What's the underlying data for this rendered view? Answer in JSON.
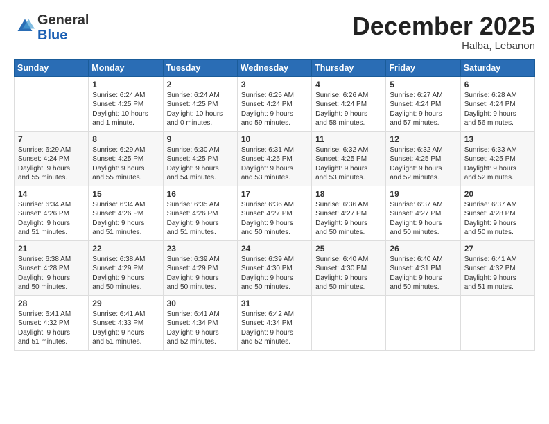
{
  "logo": {
    "general": "General",
    "blue": "Blue"
  },
  "header": {
    "month": "December 2025",
    "location": "Halba, Lebanon"
  },
  "days_of_week": [
    "Sunday",
    "Monday",
    "Tuesday",
    "Wednesday",
    "Thursday",
    "Friday",
    "Saturday"
  ],
  "weeks": [
    [
      {
        "day": "",
        "info": ""
      },
      {
        "day": "1",
        "info": "Sunrise: 6:24 AM\nSunset: 4:25 PM\nDaylight: 10 hours\nand 1 minute."
      },
      {
        "day": "2",
        "info": "Sunrise: 6:24 AM\nSunset: 4:25 PM\nDaylight: 10 hours\nand 0 minutes."
      },
      {
        "day": "3",
        "info": "Sunrise: 6:25 AM\nSunset: 4:24 PM\nDaylight: 9 hours\nand 59 minutes."
      },
      {
        "day": "4",
        "info": "Sunrise: 6:26 AM\nSunset: 4:24 PM\nDaylight: 9 hours\nand 58 minutes."
      },
      {
        "day": "5",
        "info": "Sunrise: 6:27 AM\nSunset: 4:24 PM\nDaylight: 9 hours\nand 57 minutes."
      },
      {
        "day": "6",
        "info": "Sunrise: 6:28 AM\nSunset: 4:24 PM\nDaylight: 9 hours\nand 56 minutes."
      }
    ],
    [
      {
        "day": "7",
        "info": "Sunrise: 6:29 AM\nSunset: 4:24 PM\nDaylight: 9 hours\nand 55 minutes."
      },
      {
        "day": "8",
        "info": "Sunrise: 6:29 AM\nSunset: 4:25 PM\nDaylight: 9 hours\nand 55 minutes."
      },
      {
        "day": "9",
        "info": "Sunrise: 6:30 AM\nSunset: 4:25 PM\nDaylight: 9 hours\nand 54 minutes."
      },
      {
        "day": "10",
        "info": "Sunrise: 6:31 AM\nSunset: 4:25 PM\nDaylight: 9 hours\nand 53 minutes."
      },
      {
        "day": "11",
        "info": "Sunrise: 6:32 AM\nSunset: 4:25 PM\nDaylight: 9 hours\nand 53 minutes."
      },
      {
        "day": "12",
        "info": "Sunrise: 6:32 AM\nSunset: 4:25 PM\nDaylight: 9 hours\nand 52 minutes."
      },
      {
        "day": "13",
        "info": "Sunrise: 6:33 AM\nSunset: 4:25 PM\nDaylight: 9 hours\nand 52 minutes."
      }
    ],
    [
      {
        "day": "14",
        "info": "Sunrise: 6:34 AM\nSunset: 4:26 PM\nDaylight: 9 hours\nand 51 minutes."
      },
      {
        "day": "15",
        "info": "Sunrise: 6:34 AM\nSunset: 4:26 PM\nDaylight: 9 hours\nand 51 minutes."
      },
      {
        "day": "16",
        "info": "Sunrise: 6:35 AM\nSunset: 4:26 PM\nDaylight: 9 hours\nand 51 minutes."
      },
      {
        "day": "17",
        "info": "Sunrise: 6:36 AM\nSunset: 4:27 PM\nDaylight: 9 hours\nand 50 minutes."
      },
      {
        "day": "18",
        "info": "Sunrise: 6:36 AM\nSunset: 4:27 PM\nDaylight: 9 hours\nand 50 minutes."
      },
      {
        "day": "19",
        "info": "Sunrise: 6:37 AM\nSunset: 4:27 PM\nDaylight: 9 hours\nand 50 minutes."
      },
      {
        "day": "20",
        "info": "Sunrise: 6:37 AM\nSunset: 4:28 PM\nDaylight: 9 hours\nand 50 minutes."
      }
    ],
    [
      {
        "day": "21",
        "info": "Sunrise: 6:38 AM\nSunset: 4:28 PM\nDaylight: 9 hours\nand 50 minutes."
      },
      {
        "day": "22",
        "info": "Sunrise: 6:38 AM\nSunset: 4:29 PM\nDaylight: 9 hours\nand 50 minutes."
      },
      {
        "day": "23",
        "info": "Sunrise: 6:39 AM\nSunset: 4:29 PM\nDaylight: 9 hours\nand 50 minutes."
      },
      {
        "day": "24",
        "info": "Sunrise: 6:39 AM\nSunset: 4:30 PM\nDaylight: 9 hours\nand 50 minutes."
      },
      {
        "day": "25",
        "info": "Sunrise: 6:40 AM\nSunset: 4:30 PM\nDaylight: 9 hours\nand 50 minutes."
      },
      {
        "day": "26",
        "info": "Sunrise: 6:40 AM\nSunset: 4:31 PM\nDaylight: 9 hours\nand 50 minutes."
      },
      {
        "day": "27",
        "info": "Sunrise: 6:41 AM\nSunset: 4:32 PM\nDaylight: 9 hours\nand 51 minutes."
      }
    ],
    [
      {
        "day": "28",
        "info": "Sunrise: 6:41 AM\nSunset: 4:32 PM\nDaylight: 9 hours\nand 51 minutes."
      },
      {
        "day": "29",
        "info": "Sunrise: 6:41 AM\nSunset: 4:33 PM\nDaylight: 9 hours\nand 51 minutes."
      },
      {
        "day": "30",
        "info": "Sunrise: 6:41 AM\nSunset: 4:34 PM\nDaylight: 9 hours\nand 52 minutes."
      },
      {
        "day": "31",
        "info": "Sunrise: 6:42 AM\nSunset: 4:34 PM\nDaylight: 9 hours\nand 52 minutes."
      },
      {
        "day": "",
        "info": ""
      },
      {
        "day": "",
        "info": ""
      },
      {
        "day": "",
        "info": ""
      }
    ]
  ]
}
